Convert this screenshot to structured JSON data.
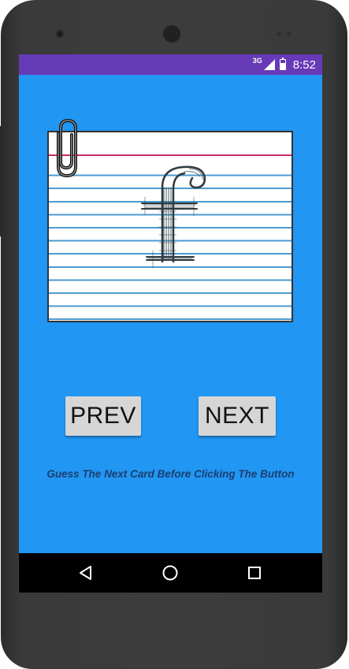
{
  "status_bar": {
    "network_label": "3G",
    "time": "8:52",
    "icons": [
      "signal-icon",
      "battery-charging-icon"
    ],
    "background_color": "#673ab7"
  },
  "app": {
    "background_color": "#2196f3",
    "card": {
      "letter": "f",
      "decoration": "paperclip-icon"
    },
    "buttons": {
      "prev_label": "PREV",
      "next_label": "NEXT"
    },
    "hint_text": "Guess The Next Card Before Clicking The Button"
  },
  "nav_bar": {
    "icons": [
      "back-icon",
      "home-icon",
      "recents-icon"
    ]
  }
}
